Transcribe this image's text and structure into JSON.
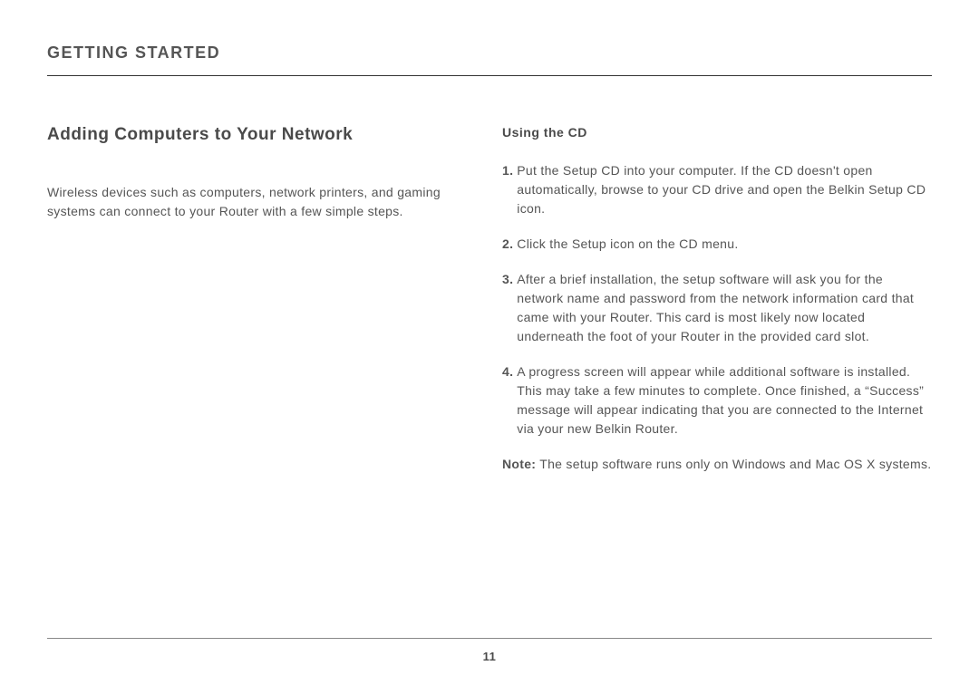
{
  "header": {
    "title": "GETTING STARTED"
  },
  "main": {
    "heading": "Adding Computers to Your Network",
    "intro": "Wireless devices such as computers, network printers, and gaming systems can connect to your Router with a few simple steps."
  },
  "cd": {
    "heading": "Using the CD",
    "steps": [
      {
        "num": "1.",
        "text": "Put the Setup CD into your computer. If the CD doesn't open automatically, browse to your CD drive and open the Belkin Setup CD icon."
      },
      {
        "num": "2.",
        "text": "Click the Setup icon on the CD menu."
      },
      {
        "num": "3.",
        "text": "After a brief installation, the setup software will ask you for the network name and password from the network information card that came with your Router. This card is most likely now located underneath the foot of your Router in the provided card slot."
      },
      {
        "num": "4.",
        "text": "A progress screen will appear while additional software is installed. This may take a few minutes to complete. Once finished, a “Success” message will appear indicating that you are connected to the Internet via your new Belkin Router."
      }
    ],
    "note_label": "Note:",
    "note_text": " The setup software runs only on Windows and Mac OS X systems."
  },
  "footer": {
    "page": "11"
  }
}
